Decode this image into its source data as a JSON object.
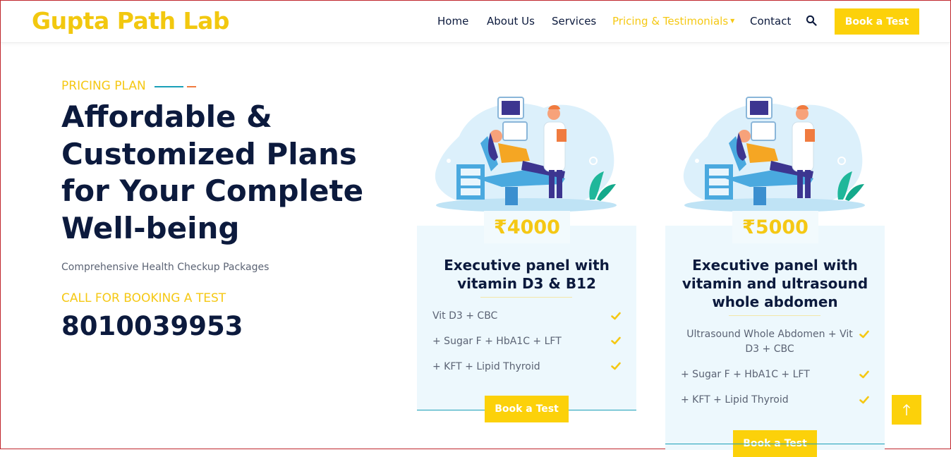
{
  "brand": {
    "name": "Gupta Path Lab"
  },
  "nav": {
    "items": [
      {
        "label": "Home"
      },
      {
        "label": "About Us"
      },
      {
        "label": "Services"
      },
      {
        "label": "Pricing & Testimonials",
        "active": true,
        "has_dropdown": true
      },
      {
        "label": "Contact"
      }
    ],
    "search_icon": "search-icon",
    "cta_label": "Book a Test"
  },
  "hero": {
    "eyebrow": "PRICING PLAN",
    "title": "Affordable & Customized Plans for Your Complete Well-being",
    "subtitle": "Comprehensive Health Checkup Packages",
    "call_label": "CALL FOR BOOKING A TEST",
    "phone": "8010039953"
  },
  "plans": [
    {
      "price": "₹4000",
      "title": "Executive panel with vitamin D3 & B12",
      "features": [
        "Vit D3 + CBC",
        "+ Sugar F + HbA1C + LFT",
        "+ KFT + Lipid Thyroid"
      ],
      "button_label": "Book a Test"
    },
    {
      "price": "₹5000",
      "title": "Executive panel with vitamin and ultrasound whole abdomen",
      "features": [
        "Ultrasound Whole Abdomen + Vit D3 + CBC",
        "+ Sugar F + HbA1C + LFT",
        "+ KFT + Lipid Thyroid"
      ],
      "button_label": "Book a Test"
    }
  ],
  "scroll_top_icon": "arrow-up-icon",
  "colors": {
    "brand_yellow": "#f5c814",
    "button_yellow": "#fcd10a",
    "navy": "#0c1a3d",
    "card_bg": "#edf8fd",
    "teal_line": "#1aa0b8",
    "accent_orange": "#f07b3f",
    "window_border": "#c0262c"
  }
}
